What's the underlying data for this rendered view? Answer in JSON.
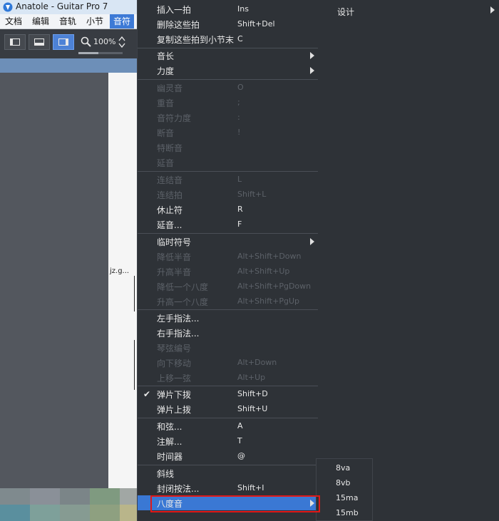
{
  "window": {
    "title": "Anatole - Guitar Pro 7"
  },
  "menubar": [
    {
      "label": "文档"
    },
    {
      "label": "编辑"
    },
    {
      "label": "音轨"
    },
    {
      "label": "小节"
    },
    {
      "label": "音符",
      "active": true
    }
  ],
  "toolbar": {
    "zoom_value": "100%",
    "zoom_slider_level": 0.45
  },
  "score": {
    "visible_text": "jz.g..."
  },
  "note_menu": {
    "items": [
      {
        "label": "插入一拍",
        "shortcut": "Ins",
        "enabled": true
      },
      {
        "label": "删除这些拍",
        "shortcut": "Shift+Del",
        "enabled": true
      },
      {
        "label": "复制这些拍到小节末",
        "shortcut": "C",
        "enabled": true
      },
      {
        "label": "音长",
        "shortcut": "",
        "enabled": true,
        "submenu": true
      },
      {
        "label": "力度",
        "shortcut": "",
        "enabled": true,
        "submenu": true
      },
      {
        "label": "幽灵音",
        "shortcut": "O",
        "enabled": false
      },
      {
        "label": "重音",
        "shortcut": ";",
        "enabled": false
      },
      {
        "label": "音符力度",
        "shortcut": ":",
        "enabled": false
      },
      {
        "label": "断音",
        "shortcut": "!",
        "enabled": false
      },
      {
        "label": "特断音",
        "shortcut": "",
        "enabled": false
      },
      {
        "label": "延音",
        "shortcut": "",
        "enabled": false
      },
      {
        "label": "连结音",
        "shortcut": "L",
        "enabled": false
      },
      {
        "label": "连结拍",
        "shortcut": "Shift+L",
        "enabled": false
      },
      {
        "label": "休止符",
        "shortcut": "R",
        "enabled": true
      },
      {
        "label": "延音...",
        "shortcut": "F",
        "enabled": true
      },
      {
        "label": "临时符号",
        "shortcut": "",
        "enabled": true,
        "submenu": true
      },
      {
        "label": "降低半音",
        "shortcut": "Alt+Shift+Down",
        "enabled": false
      },
      {
        "label": "升高半音",
        "shortcut": "Alt+Shift+Up",
        "enabled": false
      },
      {
        "label": "降低一个八度",
        "shortcut": "Alt+Shift+PgDown",
        "enabled": false
      },
      {
        "label": "升高一个八度",
        "shortcut": "Alt+Shift+PgUp",
        "enabled": false
      },
      {
        "label": "左手指法...",
        "shortcut": "",
        "enabled": true
      },
      {
        "label": "右手指法...",
        "shortcut": "",
        "enabled": true
      },
      {
        "label": "琴弦编号",
        "shortcut": "",
        "enabled": false
      },
      {
        "label": "向下移动",
        "shortcut": "Alt+Down",
        "enabled": false
      },
      {
        "label": "上移一弦",
        "shortcut": "Alt+Up",
        "enabled": false
      },
      {
        "label": "弹片下拨",
        "shortcut": "Shift+D",
        "enabled": true,
        "checked": true
      },
      {
        "label": "弹片上拨",
        "shortcut": "Shift+U",
        "enabled": true
      },
      {
        "label": "和弦...",
        "shortcut": "A",
        "enabled": true
      },
      {
        "label": "注解...",
        "shortcut": "T",
        "enabled": true
      },
      {
        "label": "时间器",
        "shortcut": "@",
        "enabled": true
      },
      {
        "label": "斜线",
        "shortcut": "",
        "enabled": true
      },
      {
        "label": "封闭按法...",
        "shortcut": "Shift+I",
        "enabled": true
      },
      {
        "label": "八度音",
        "shortcut": "",
        "enabled": true,
        "submenu": true,
        "highlighted": true
      }
    ]
  },
  "right_menu": {
    "label": "设计"
  },
  "octave_submenu": {
    "items": [
      {
        "label": "8va"
      },
      {
        "label": "8vb"
      },
      {
        "label": "15ma"
      },
      {
        "label": "15mb"
      }
    ]
  },
  "colors": {
    "menu_bg": "#2e3237",
    "highlight": "#3a78d4",
    "callout": "#e01818",
    "disabled_text": "#5c6168"
  }
}
